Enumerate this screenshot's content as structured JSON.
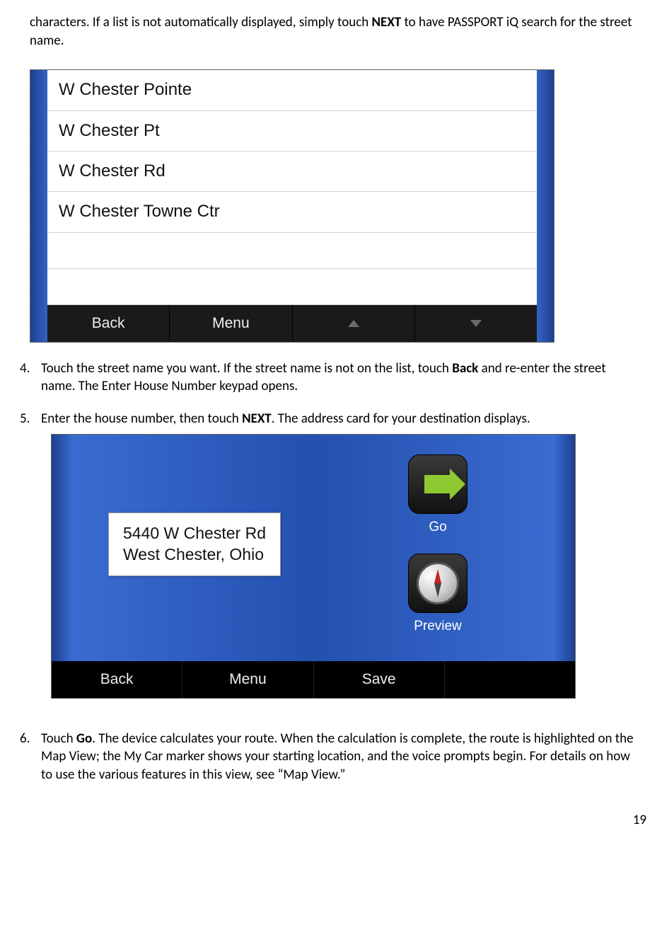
{
  "intro": {
    "line1_a": "characters. If a list is not automatically displayed, simply touch ",
    "line1_b": "NEXT",
    "line1_c": " to have PASSPORT iQ search for the street name."
  },
  "screenshot1": {
    "streets": [
      "W Chester Pointe",
      "W Chester Pt",
      "W Chester Rd",
      "W Chester Towne Ctr"
    ],
    "toolbar": {
      "back": "Back",
      "menu": "Menu"
    }
  },
  "steps": {
    "s4": {
      "num": "4.",
      "a": "Touch the street name you want. If the street name is not on the list, touch ",
      "b": "Back",
      "c": " and re-enter the street name. The Enter House Number keypad opens."
    },
    "s5": {
      "num": "5.",
      "a": "Enter the house number, then touch ",
      "b": "NEXT",
      "c": ". The address card for your destination displays."
    },
    "s6": {
      "num": "6.",
      "a": "Touch ",
      "b": "Go",
      "c": ". The device calculates your route. When the calculation is complete, the route is highlighted on the Map View; the My Car marker shows your starting location, and the voice prompts begin. For details on how to use the various features in this view, see “Map View.”"
    }
  },
  "screenshot2": {
    "address_line1": "5440 W Chester Rd",
    "address_line2": "West Chester, Ohio",
    "go_label": "Go",
    "preview_label": "Preview",
    "toolbar": {
      "back": "Back",
      "menu": "Menu",
      "save": "Save"
    }
  },
  "page_number": "19"
}
